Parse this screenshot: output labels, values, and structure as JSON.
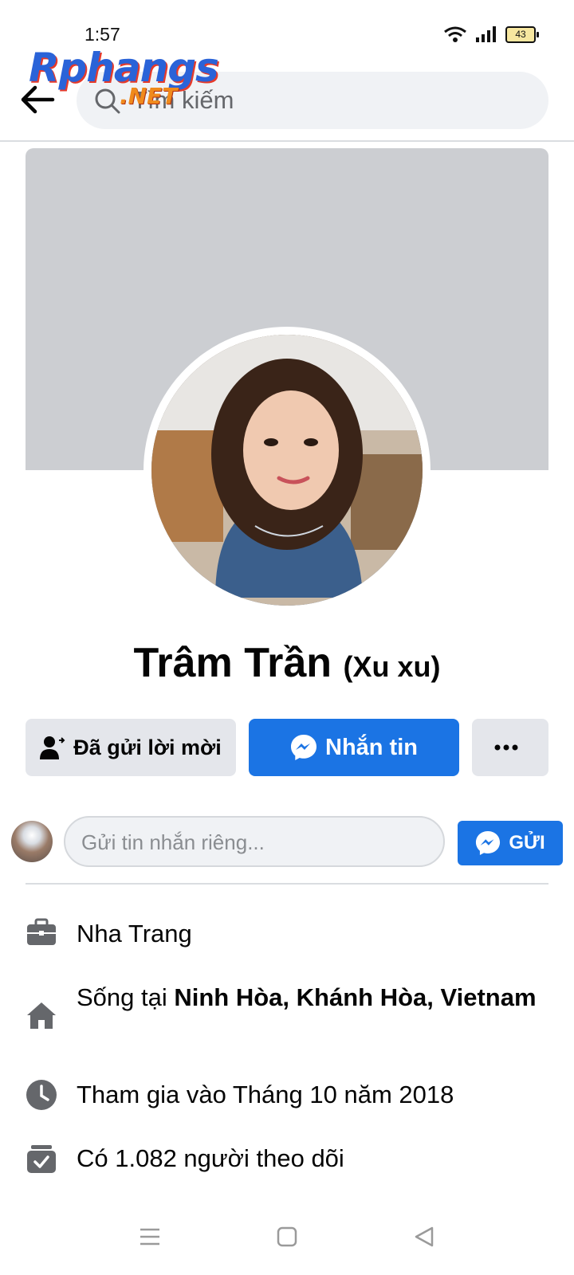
{
  "status_bar": {
    "time": "1:57",
    "battery": "43"
  },
  "watermark": {
    "main": "Rphangs",
    "sub": ".NET"
  },
  "search": {
    "placeholder": "Tìm kiếm",
    "visible_text": "m kiếm"
  },
  "profile": {
    "name": "Trâm Trần",
    "nickname": "(Xu xu)"
  },
  "actions": {
    "sent_request_label": "Đã gửi lời mời",
    "message_label": "Nhắn tin",
    "more_label": "···"
  },
  "message_bar": {
    "placeholder": "Gửi tin nhắn riêng...",
    "send_label": "GỬI"
  },
  "info": {
    "work": "Nha Trang",
    "lives_prefix": "Sống tại ",
    "lives_place": "Ninh Hòa, Khánh Hòa, Vietnam",
    "joined": "Tham gia vào Tháng 10 năm 2018",
    "followers": "Có 1.082 người theo dõi"
  },
  "colors": {
    "accent": "#1b74e4",
    "button_gray": "#e4e6eb",
    "cover": "#ccced2",
    "icon_gray": "#65676b"
  },
  "icons": [
    "back-arrow-icon",
    "search-icon",
    "add-friend-icon",
    "messenger-icon",
    "more-icon",
    "briefcase-icon",
    "home-icon",
    "clock-icon",
    "followers-icon",
    "menu-icon",
    "home-square-icon",
    "back-triangle-icon"
  ]
}
